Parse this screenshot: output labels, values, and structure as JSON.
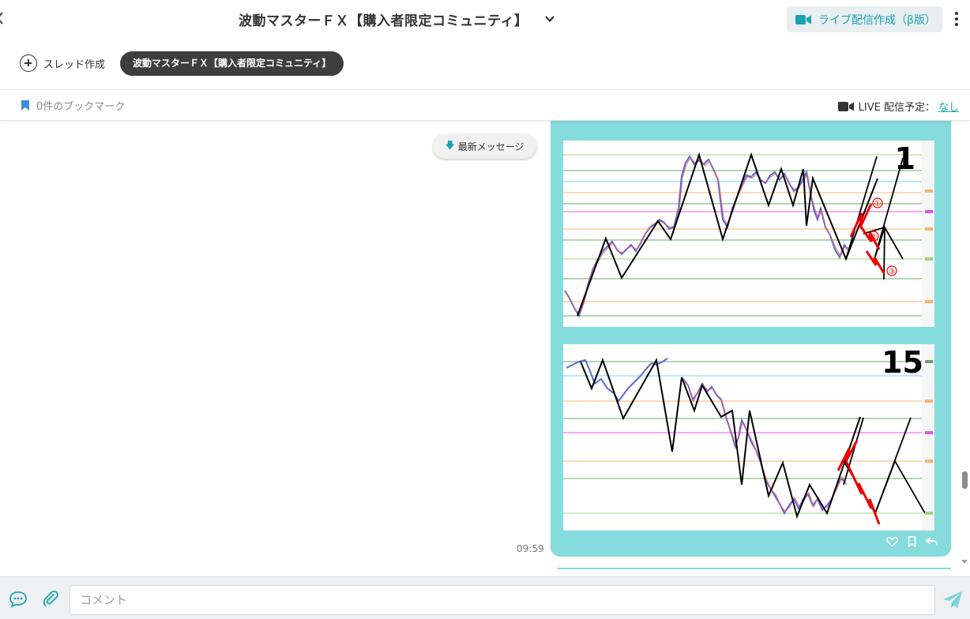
{
  "header": {
    "title": "波動マスターＦＸ【購入者限定コミュニティ】",
    "live_button_label": "ライブ配信作成（β版）"
  },
  "tabs": {
    "thread_create_label": "スレッド作成",
    "active_tab_label": "波動マスターＦＸ【購入者限定コミュニティ】"
  },
  "subbar": {
    "bookmarks_label": "0件のブックマーク",
    "live_schedule_label": "LIVE 配信予定：",
    "live_schedule_value": "なし"
  },
  "chat": {
    "latest_messages_label": "最新メッセージ",
    "message_time": "09:59",
    "chart1_label": "1",
    "chart2_label": "15",
    "chart1_marks": [
      "①",
      "②",
      "③"
    ]
  },
  "composer": {
    "placeholder": "コメント"
  },
  "colors": {
    "accent": "#1aa3b3",
    "bubble": "#86dbdc",
    "active_tab": "#3e3e3e"
  },
  "icons": [
    "back-chevron-icon",
    "chevron-down-icon",
    "video-camera-icon",
    "kebab-menu-icon",
    "plus-circle-icon",
    "bookmark-icon",
    "arrow-down-icon",
    "heart-icon",
    "bookmark-outline-icon",
    "reply-icon",
    "chat-bubble-icon",
    "paperclip-icon",
    "send-icon"
  ]
}
